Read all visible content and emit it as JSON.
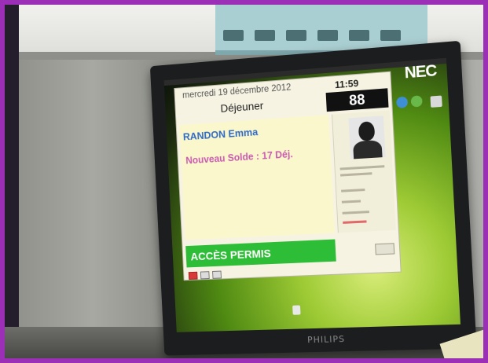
{
  "app": {
    "date": "mercredi 19 décembre 2012",
    "time": "11:59",
    "meal": "Déjeuner",
    "count": "88",
    "student_name": "RANDON  Emma",
    "balance": "Nouveau Solde : 17 Déj.",
    "access_status": "ACCÈS  PERMIS"
  },
  "hardware": {
    "monitor_brand": "PHILIPS",
    "badge_brand": "NEC"
  },
  "colors": {
    "access_green": "#2ebd37",
    "name_blue": "#2f6ac9",
    "balance_pink": "#c95bb0",
    "frame_purple": "#9b2fb5"
  },
  "icons": [
    "photo-icon",
    "toolbar-icon",
    "desktop-icon"
  ]
}
